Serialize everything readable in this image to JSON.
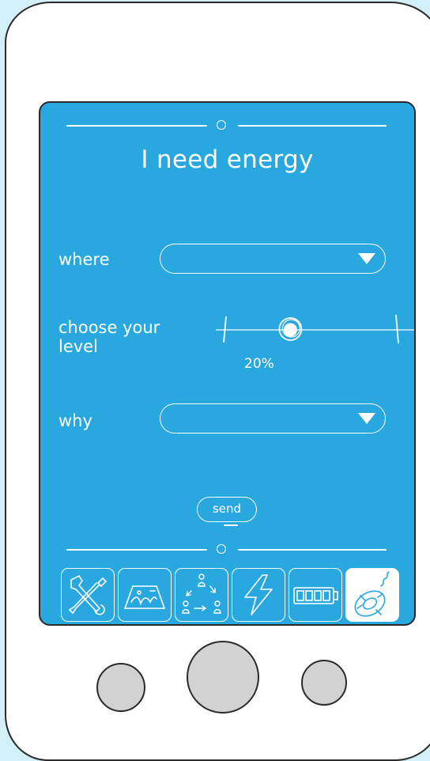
{
  "screen": {
    "title": "I need energy",
    "where": {
      "label": "where",
      "value": ""
    },
    "level": {
      "label": "choose your level",
      "value_text": "20%",
      "fraction": 0.2
    },
    "why": {
      "label": "why",
      "value": ""
    },
    "send_label": "send"
  },
  "toolbar": {
    "items": [
      {
        "icon": "tools-icon",
        "active": false
      },
      {
        "icon": "landscape-icon",
        "active": false
      },
      {
        "icon": "people-cycle-icon",
        "active": false
      },
      {
        "icon": "lightning-icon",
        "active": false
      },
      {
        "icon": "battery-icon",
        "active": false
      },
      {
        "icon": "lifebuoy-icon",
        "active": true
      }
    ]
  },
  "colors": {
    "screen_bg": "#29a8e0",
    "page_bg": "#d3eff7",
    "device": "#ffffff",
    "hardware_button": "#d2d2d2",
    "foreground": "#ffffff"
  }
}
